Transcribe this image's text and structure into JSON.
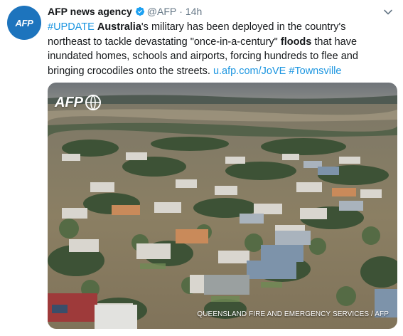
{
  "tweet": {
    "account_name": "AFP news agency",
    "handle": "@AFP",
    "separator": "·",
    "time": "14h",
    "avatar_text": "AFP",
    "icons": {
      "verified": "verified-badge-icon",
      "menu": "chevron-down-icon"
    },
    "text": {
      "hashtag_update": "#UPDATE",
      "keyword_australia": "Australia",
      "part1": "'s military has been deployed in the country's northeast to tackle devastating \"once-in-a-century\" ",
      "keyword_floods": "floods",
      "part2": " that have inundated homes, schools and airports, forcing hundreds to flee and bringing crocodiles onto the streets. ",
      "link": "u.afp.com/JoVE",
      "hashtag_townsville": "#Townsville"
    },
    "media": {
      "watermark": "AFP",
      "credit": "QUEENSLAND FIRE AND EMERGENCY SERVICES / AFP"
    }
  },
  "colors": {
    "link": "#1b95e0",
    "brand": "#1d74bd",
    "text": "#14171a",
    "muted": "#657786",
    "flood_water": "#8a7e63"
  }
}
